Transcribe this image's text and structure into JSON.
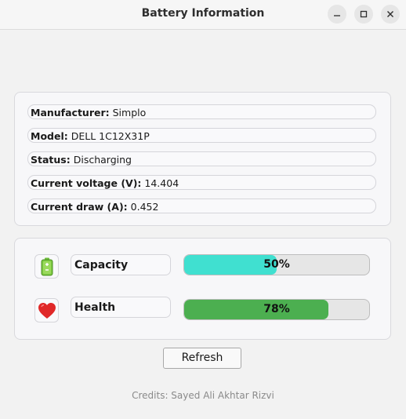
{
  "window": {
    "title": "Battery Information",
    "controls": [
      "minimize-icon",
      "maximize-icon",
      "close-icon"
    ]
  },
  "info": {
    "manufacturer": {
      "label": "Manufacturer:",
      "value": "Simplo"
    },
    "model": {
      "label": "Model:",
      "value": "DELL 1C12X31P"
    },
    "status": {
      "label": "Status:",
      "value": "Discharging"
    },
    "voltage": {
      "label": "Current voltage (V):",
      "value": "14.404"
    },
    "draw": {
      "label": "Current draw (A):",
      "value": "0.452"
    }
  },
  "stats": {
    "capacity": {
      "icon": "battery-icon",
      "label": "Capacity",
      "percent": 50,
      "text": "50%",
      "color": "#40e0d0"
    },
    "health": {
      "icon": "heart-icon",
      "label": "Health",
      "percent": 78,
      "text": "78%",
      "color": "#4caf50"
    }
  },
  "refresh_label": "Refresh",
  "credits": "Credits: Sayed Ali Akhtar Rizvi"
}
